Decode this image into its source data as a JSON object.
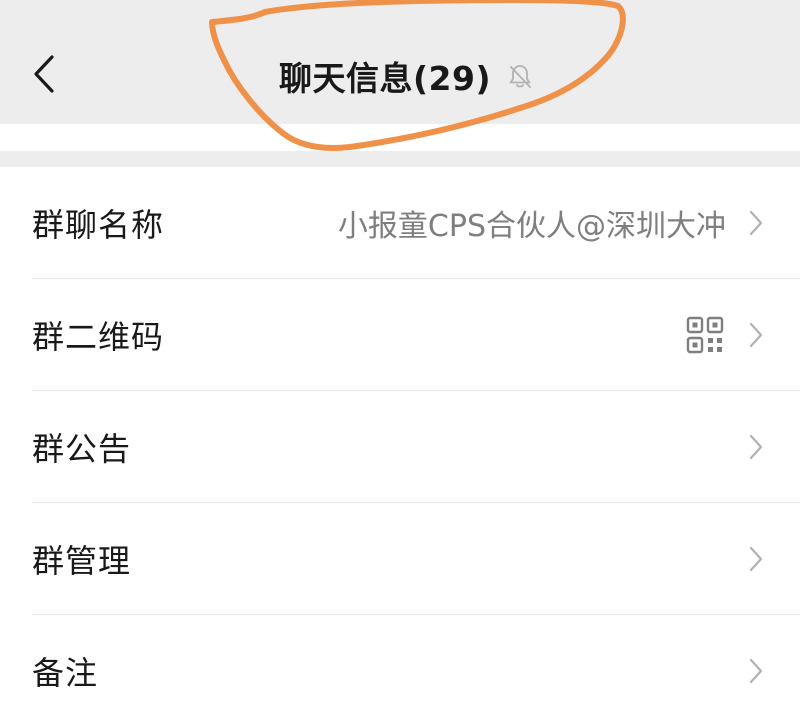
{
  "header": {
    "title": "聊天信息(29)",
    "back_icon": "chevron-left-icon",
    "mute_icon": "bell-off-icon"
  },
  "rows": [
    {
      "label": "群聊名称",
      "value": "小报童CPS合伙人@深圳大冲",
      "trailing_icon": "chevron-right-icon"
    },
    {
      "label": "群二维码",
      "value": "",
      "extra_icon": "qr-code-icon",
      "trailing_icon": "chevron-right-icon"
    },
    {
      "label": "群公告",
      "value": "",
      "trailing_icon": "chevron-right-icon"
    },
    {
      "label": "群管理",
      "value": "",
      "trailing_icon": "chevron-right-icon"
    },
    {
      "label": "备注",
      "value": "",
      "trailing_icon": "chevron-right-icon"
    }
  ],
  "colors": {
    "background": "#ededed",
    "surface": "#ffffff",
    "text_primary": "#191919",
    "text_secondary": "#7f7f7f",
    "icon_gray": "#b2b2b2",
    "divider": "#e5e5e5",
    "annotation_orange": "#f0914a"
  }
}
